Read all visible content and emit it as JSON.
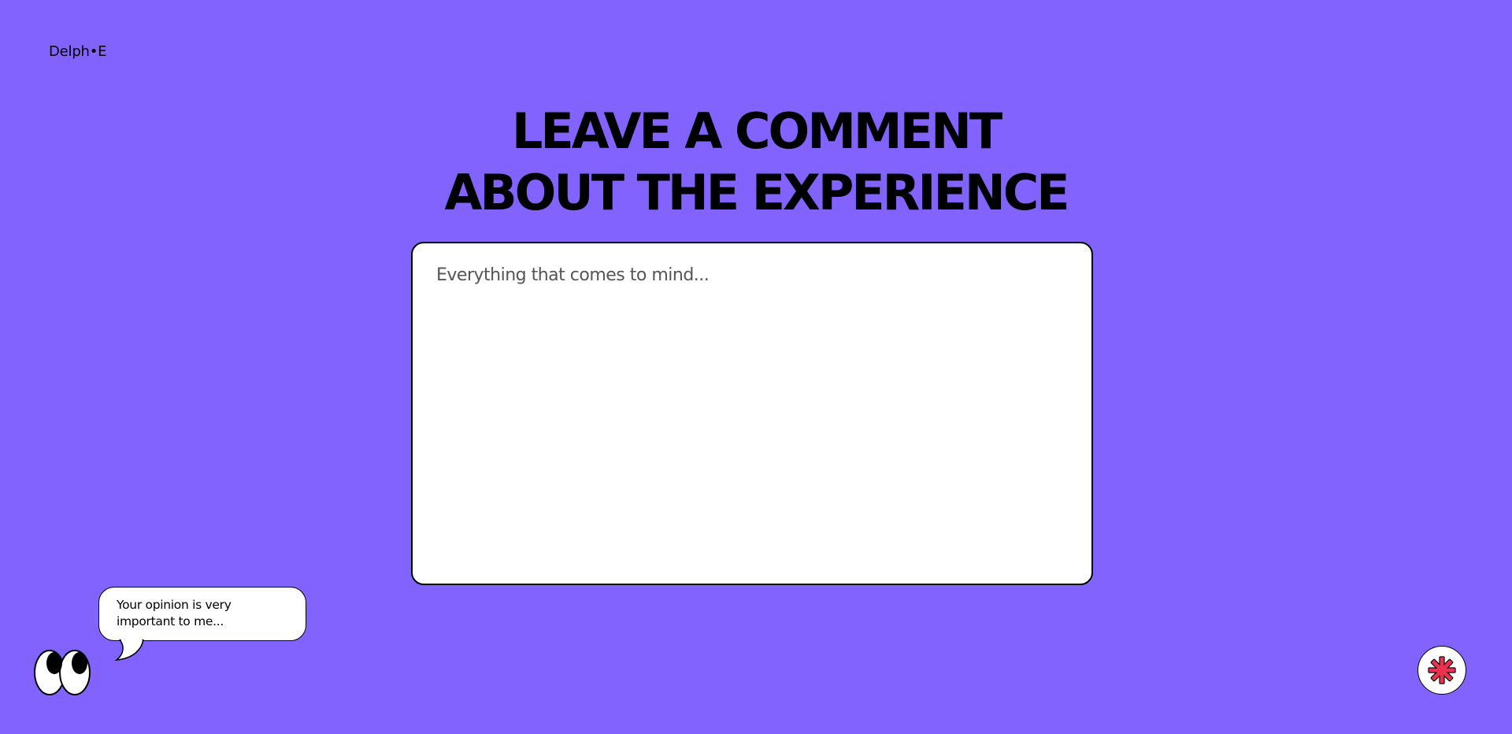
{
  "brand": {
    "logo_text": "Delph•E"
  },
  "headline": {
    "line1": "LEAVE A COMMENT",
    "line2": "ABOUT THE EXPERIENCE"
  },
  "comment": {
    "placeholder": "Everything that comes to mind...",
    "value": ""
  },
  "mascot": {
    "bubble_line1": "Your opinion is very",
    "bubble_line2": "important to me...",
    "icon": "eyes-icon"
  },
  "action": {
    "icon": "asterisk-icon",
    "accent_color": "#e8324f"
  },
  "colors": {
    "background": "#8363fd",
    "surface": "#ffffff",
    "ink": "#000000"
  }
}
